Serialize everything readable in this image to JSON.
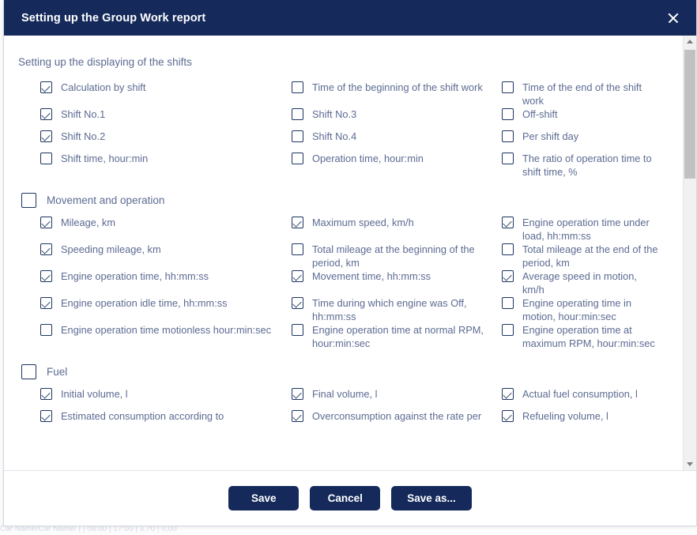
{
  "dialog": {
    "title": "Setting up the Group Work report",
    "close_icon": "close-icon"
  },
  "sections": [
    {
      "id": "shifts",
      "title": "Setting up the displaying of the shifts",
      "has_group_checkbox": false,
      "rows": [
        [
          {
            "label": "Calculation by shift",
            "checked": true
          },
          {
            "label": "Time of the beginning of the shift work",
            "checked": false
          },
          {
            "label": "Time of the end of the shift work",
            "checked": false
          }
        ],
        [
          {
            "label": "Shift No.1",
            "checked": true
          },
          {
            "label": "Shift No.3",
            "checked": false
          },
          {
            "label": "Off-shift",
            "checked": false
          }
        ],
        [
          {
            "label": "Shift No.2",
            "checked": true
          },
          {
            "label": "Shift No.4",
            "checked": false
          },
          {
            "label": "Per shift day",
            "checked": false
          }
        ],
        [
          {
            "label": "Shift time, hour:min",
            "checked": false
          },
          {
            "label": "Operation time, hour:min",
            "checked": false
          },
          {
            "label": "The ratio of operation time to shift time, %",
            "checked": false
          }
        ]
      ]
    },
    {
      "id": "movement",
      "title": "Movement and operation",
      "has_group_checkbox": true,
      "group_checked": false,
      "rows": [
        [
          {
            "label": "Mileage, km",
            "checked": true
          },
          {
            "label": "Maximum speed, km/h",
            "checked": true
          },
          {
            "label": "Engine operation time under load, hh:mm:ss",
            "checked": true
          }
        ],
        [
          {
            "label": "Speeding mileage, km",
            "checked": true
          },
          {
            "label": "Total mileage at the beginning of the period, km",
            "checked": false
          },
          {
            "label": "Total mileage at the end of the period, km",
            "checked": false
          }
        ],
        [
          {
            "label": "Engine operation time, hh:mm:ss",
            "checked": true
          },
          {
            "label": "Movement time, hh:mm:ss",
            "checked": true
          },
          {
            "label": "Average speed in motion, km/h",
            "checked": true
          }
        ],
        [
          {
            "label": "Engine operation idle time, hh:mm:ss",
            "checked": true
          },
          {
            "label": "Time during which engine was Off, hh:mm:ss",
            "checked": true
          },
          {
            "label": "Engine operating time in motion, hour:min:sec",
            "checked": false
          }
        ],
        [
          {
            "label": "Engine operation time motionless hour:min:sec",
            "checked": false
          },
          {
            "label": "Engine operation time at normal RPM, hour:min:sec",
            "checked": false
          },
          {
            "label": "Engine operation time at maximum RPM, hour:min:sec",
            "checked": false
          }
        ]
      ]
    },
    {
      "id": "fuel",
      "title": "Fuel",
      "has_group_checkbox": true,
      "group_checked": false,
      "rows": [
        [
          {
            "label": "Initial volume, l",
            "checked": true
          },
          {
            "label": "Final volume, l",
            "checked": true
          },
          {
            "label": "Actual fuel consumption, l",
            "checked": true
          }
        ],
        [
          {
            "label": "Estimated consumption according to",
            "checked": true
          },
          {
            "label": "Overconsumption against the rate per",
            "checked": true
          },
          {
            "label": "Refueling volume, l",
            "checked": true
          }
        ]
      ]
    }
  ],
  "footer": {
    "save_label": "Save",
    "cancel_label": "Cancel",
    "save_as_label": "Save as..."
  },
  "scrollbar": {
    "up_icon": "chevron-up-icon",
    "down_icon": "chevron-down-icon"
  },
  "colors": {
    "header_bg": "#152A5B",
    "text": "#5c6b92",
    "checkbox_border": "#1d3461",
    "button_bg": "#152A5B"
  },
  "background_ghost_rows": [
    "Car Name/Car Name/    |        |   08:00      | 17:00      |  3,70        |     0,00"
  ]
}
